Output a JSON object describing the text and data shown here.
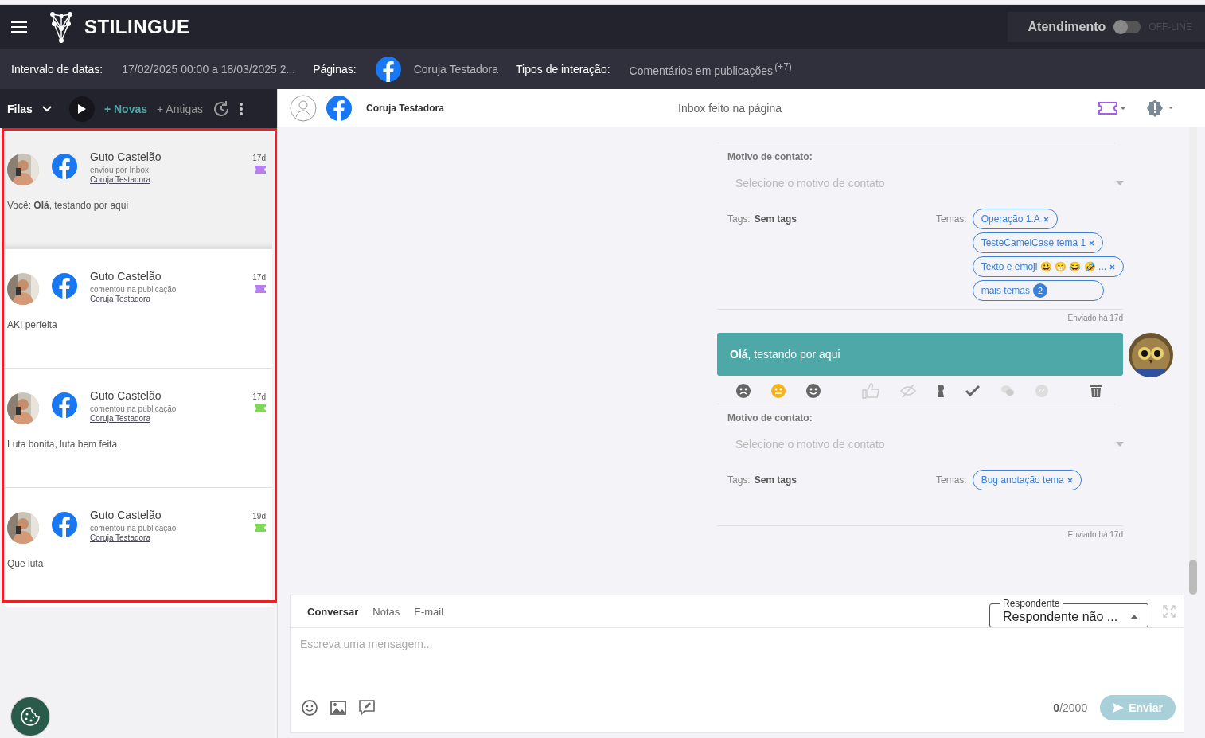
{
  "topbar": {
    "brand": "STILINGUE",
    "service_label": "Atendimento",
    "service_on": false,
    "service_status": "OFF-LINE"
  },
  "filters": [
    {
      "label": "Intervalo de datas:",
      "value": "17/02/2025 00:00 a 18/03/2025 2...",
      "kind": "text"
    },
    {
      "label": "Páginas:",
      "value": "Coruja Testadora",
      "kind": "page"
    },
    {
      "label": "Tipos de interação:",
      "value": "Comentários em publicações",
      "extra": "(+7)",
      "kind": "text"
    }
  ],
  "queue": {
    "title": "Filas",
    "buttons": [
      {
        "label": "+ Novas",
        "selected": true
      },
      {
        "label": "+ Antigas",
        "selected": false
      }
    ]
  },
  "conversations": [
    {
      "name": "Guto Castelão",
      "action": "enviou por Inbox",
      "page": "Coruja Testadora",
      "time": "17d",
      "color": "#b77ef0",
      "message": "Você: **Olá**, testando por aqui",
      "selected": true
    },
    {
      "name": "Guto Castelão",
      "action": "comentou na publicação",
      "page": "Coruja Testadora",
      "time": "17d",
      "color": "#b77ef0",
      "message": "AKI perfeita",
      "selected": false
    },
    {
      "name": "Guto Castelão",
      "action": "comentou na publicação",
      "page": "Coruja Testadora",
      "time": "17d",
      "color": "#7ed957",
      "message": "Luta bonita, luta bem feita",
      "selected": false
    },
    {
      "name": "Guto Castelão",
      "action": "comentou na publicação",
      "page": "Coruja Testadora",
      "time": "19d",
      "color": "#7ed957",
      "message": "Que luta",
      "selected": false
    }
  ],
  "chat": {
    "page": "Coruja Testadora",
    "subtitle": "Inbox feito na página",
    "blocks": [
      {
        "kind": "annotation",
        "motivo_label": "Motivo de contato:",
        "motivo_placeholder": "Selecione o motivo de contato",
        "tags_label": "Tags:",
        "tags_value": "Sem tags",
        "temas_label": "Temas:",
        "temas": [
          {
            "label": "Operação 1.A",
            "kind": "chip"
          },
          {
            "label": "TesteCamelCase tema 1",
            "kind": "chip"
          },
          {
            "label": "Texto e emoji 😀 😁 😂 🤣 ...",
            "kind": "chip"
          },
          {
            "label": "mais temas",
            "count": "2",
            "kind": "more"
          }
        ],
        "sent": "Enviado há 17d",
        "toolbar": false
      },
      {
        "kind": "message",
        "text": "**Olá**, testando por aqui"
      },
      {
        "kind": "annotation",
        "motivo_label": "Motivo de contato:",
        "motivo_placeholder": "Selecione o motivo de contato",
        "tags_label": "Tags:",
        "tags_value": "Sem tags",
        "temas_label": "Temas:",
        "temas": [
          {
            "label": "Bug anotação tema",
            "kind": "chip"
          }
        ],
        "sent": "Enviado há 17d",
        "toolbar": true,
        "sentiments": [
          {
            "kind": "negative",
            "selected": false
          },
          {
            "kind": "neutral",
            "selected": true
          },
          {
            "kind": "positive",
            "selected": false
          }
        ]
      }
    ]
  },
  "composer": {
    "tabs": [
      {
        "label": "Conversar",
        "selected": true
      },
      {
        "label": "Notas",
        "selected": false
      },
      {
        "label": "E-mail",
        "selected": false
      }
    ],
    "respondent_label": "Respondente",
    "respondent_value": "Respondente não ...",
    "placeholder": "Escreva uma mensagem...",
    "count": "0",
    "limit": "/2000",
    "send": "Enviar",
    "send_disabled": true
  }
}
